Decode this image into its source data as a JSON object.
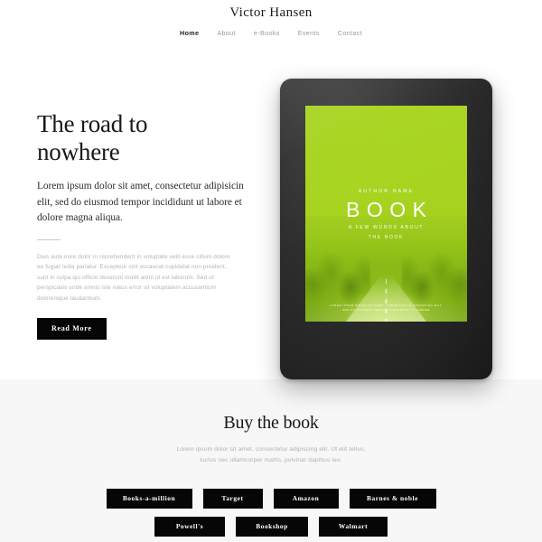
{
  "header": {
    "brand": "Victor Hansen",
    "nav": [
      {
        "label": "Home",
        "active": true
      },
      {
        "label": "About",
        "active": false
      },
      {
        "label": "e-Books",
        "active": false
      },
      {
        "label": "Events",
        "active": false
      },
      {
        "label": "Contact",
        "active": false
      }
    ]
  },
  "hero": {
    "title_line1": "The road to",
    "title_line2": "nowhere",
    "lead": "Lorem ipsum dolor sit amet, consectetur adipisicin elit, sed do eiusmod tempor incididunt ut labore et dolore magna aliqua.",
    "body": "Duis aute irure dolor in reprehenderit in voluptate velit esse cillum dolore eu fugiat nulla pariatur. Excepteur sint occaecat cupidatat non proident, sunt in culpa qui officio deserunt mollit anim id est laborum. Sed ut perspiciatis unde omnis iste natus error sit voluptatem accusantium doloremque laudantium.",
    "cta_label": "Read More"
  },
  "device": {
    "cover": {
      "author": "AUTHOR NAME",
      "title": "BOOK",
      "subtitle_line1": "A FEW WORDS ABOUT",
      "subtitle_line2": "THE BOOK",
      "footnote_line1": "LOREM IPSUM DOLOR SIT AMET, CONSECTETUR ADIPISCING ELIT,",
      "footnote_line2": "SED DO EIUSMOD TEMPOR INCIDIDUNT UT LABORE"
    }
  },
  "buy": {
    "title": "Buy the book",
    "subtitle_line1": "Lorem ipsum dolor sit amet, consectetur adipiscing elit. Ut elit tellus,",
    "subtitle_line2": "luctus nec ullamcorper mattis, pulvinar dapibus leo.",
    "stores_row1": [
      "Books-a-million",
      "Target",
      "Amazon",
      "Barnes & noble"
    ],
    "stores_row2": [
      "Powell's",
      "Bookshop",
      "Walmart"
    ]
  },
  "colors": {
    "dark": "#060606",
    "cover_green": "#a8d420",
    "section_bg": "#f7f7f7",
    "muted_text": "#b0b0b0"
  }
}
